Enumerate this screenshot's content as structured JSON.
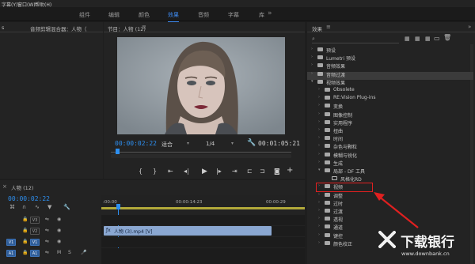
{
  "menubar": {
    "items": [
      "字幕(Y)",
      "窗口(W)",
      "帮助(H)"
    ]
  },
  "workspace": {
    "tabs": [
      "组件",
      "编辑",
      "颜色",
      "效果",
      "音频",
      "字幕",
      "库"
    ],
    "active_index": 3
  },
  "source_panel": {
    "title": "音频剪辑混合器：人物（",
    "left_title": "s"
  },
  "program": {
    "title": "节目：人物 (12)",
    "timecode": "00:00:02:22",
    "fit_label": "适合",
    "resolution": "1/4",
    "duration": "00:01:05:21"
  },
  "effects": {
    "title": "效果",
    "items": [
      {
        "label": "预设",
        "level": 0,
        "kind": "folder",
        "expanded": false
      },
      {
        "label": "Lumetri 预设",
        "level": 0,
        "kind": "folder",
        "expanded": false
      },
      {
        "label": "音频效果",
        "level": 0,
        "kind": "folder",
        "expanded": false
      },
      {
        "label": "音频过渡",
        "level": 0,
        "kind": "folder",
        "expanded": false,
        "highlight": true
      },
      {
        "label": "视频效果",
        "level": 0,
        "kind": "folder",
        "expanded": true
      },
      {
        "label": "Obsolete",
        "level": 1,
        "kind": "folder",
        "expanded": false
      },
      {
        "label": "RE:Vision Plug-ins",
        "level": 1,
        "kind": "folder",
        "expanded": false
      },
      {
        "label": "变换",
        "level": 1,
        "kind": "folder",
        "expanded": false
      },
      {
        "label": "图像控制",
        "level": 1,
        "kind": "folder",
        "expanded": false
      },
      {
        "label": "实用程序",
        "level": 1,
        "kind": "folder",
        "expanded": false
      },
      {
        "label": "扭曲",
        "level": 1,
        "kind": "folder",
        "expanded": false
      },
      {
        "label": "时间",
        "level": 1,
        "kind": "folder",
        "expanded": false
      },
      {
        "label": "杂色与颗粒",
        "level": 1,
        "kind": "folder",
        "expanded": false
      },
      {
        "label": "模糊与锐化",
        "level": 1,
        "kind": "folder",
        "expanded": false
      },
      {
        "label": "生成",
        "level": 1,
        "kind": "folder",
        "expanded": false
      },
      {
        "label": "局部 - DF 工具",
        "level": 1,
        "kind": "folder",
        "expanded": true
      },
      {
        "label": "风格化RD",
        "level": 2,
        "kind": "effect",
        "selected": true
      },
      {
        "label": "视频",
        "level": 1,
        "kind": "folder",
        "expanded": false
      },
      {
        "label": "调整",
        "level": 1,
        "kind": "folder",
        "expanded": false
      },
      {
        "label": "过时",
        "level": 1,
        "kind": "folder",
        "expanded": false
      },
      {
        "label": "过渡",
        "level": 1,
        "kind": "folder",
        "expanded": false
      },
      {
        "label": "透视",
        "level": 1,
        "kind": "folder",
        "expanded": false
      },
      {
        "label": "通道",
        "level": 1,
        "kind": "folder",
        "expanded": false
      },
      {
        "label": "键控",
        "level": 1,
        "kind": "folder",
        "expanded": false
      },
      {
        "label": "颜色校正",
        "level": 1,
        "kind": "folder",
        "expanded": false
      }
    ]
  },
  "timeline": {
    "title": "人物 (12)",
    "timecode": "00:00:02:22",
    "ruler": [
      ":00:00",
      "00:00:14:23",
      "00:00:29"
    ],
    "tracks": [
      {
        "id": "V3",
        "src": ""
      },
      {
        "id": "V2",
        "src": ""
      },
      {
        "id": "V1",
        "src": "V1"
      },
      {
        "id": "A1",
        "src": "A1"
      }
    ],
    "clip_label": "人物 (3).mp4 [V]"
  },
  "watermark": {
    "name": "下载银行",
    "url": "www.downbank.cn"
  },
  "colors": {
    "accent": "#2d8ff0",
    "selection_box": "#e02020",
    "arrow": "#e02020"
  }
}
